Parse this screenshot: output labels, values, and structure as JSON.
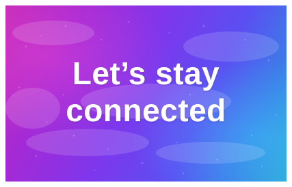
{
  "card": {
    "line1": "Let’s stay",
    "line2": "connected"
  },
  "colors": {
    "gradient_start": "#c42cb8",
    "gradient_mid": "#7f36ec",
    "gradient_end": "#2fa6d8",
    "text": "#ffffff"
  }
}
